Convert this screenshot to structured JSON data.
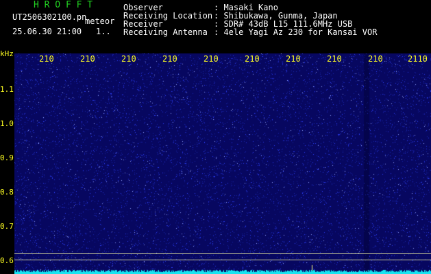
{
  "header": {
    "program_name": "H R O F F T",
    "filename": "UT2506302100.pn",
    "mode": "meteor",
    "timestamp": "25.06.30 21:00",
    "page_indicator": "1..",
    "fields": [
      {
        "label": "Observer",
        "value": ": Masaki Kano"
      },
      {
        "label": "Receiving Location",
        "value": ": Shibukawa, Gunma, Japan"
      },
      {
        "label": "Receiver",
        "value": ": SDR# 43dB L15 111.6MHz USB"
      },
      {
        "label": "Receiving Antenna",
        "value": ": 4ele Yagi Az 230 for Kansai VOR"
      }
    ]
  },
  "spectrogram": {
    "y_unit": "kHz",
    "y_ticks": [
      "1.1",
      "1.0",
      "0.9",
      "0.8",
      "0.7",
      "0.6"
    ],
    "x_ticks": [
      "210",
      "210",
      "210",
      "210",
      "210",
      "210",
      "210",
      "210",
      "210",
      "2110"
    ],
    "colors": {
      "background": "#070760",
      "noise": "#2a3cf0",
      "trace": "#17e4f0",
      "axis_text": "#ffff22"
    }
  }
}
